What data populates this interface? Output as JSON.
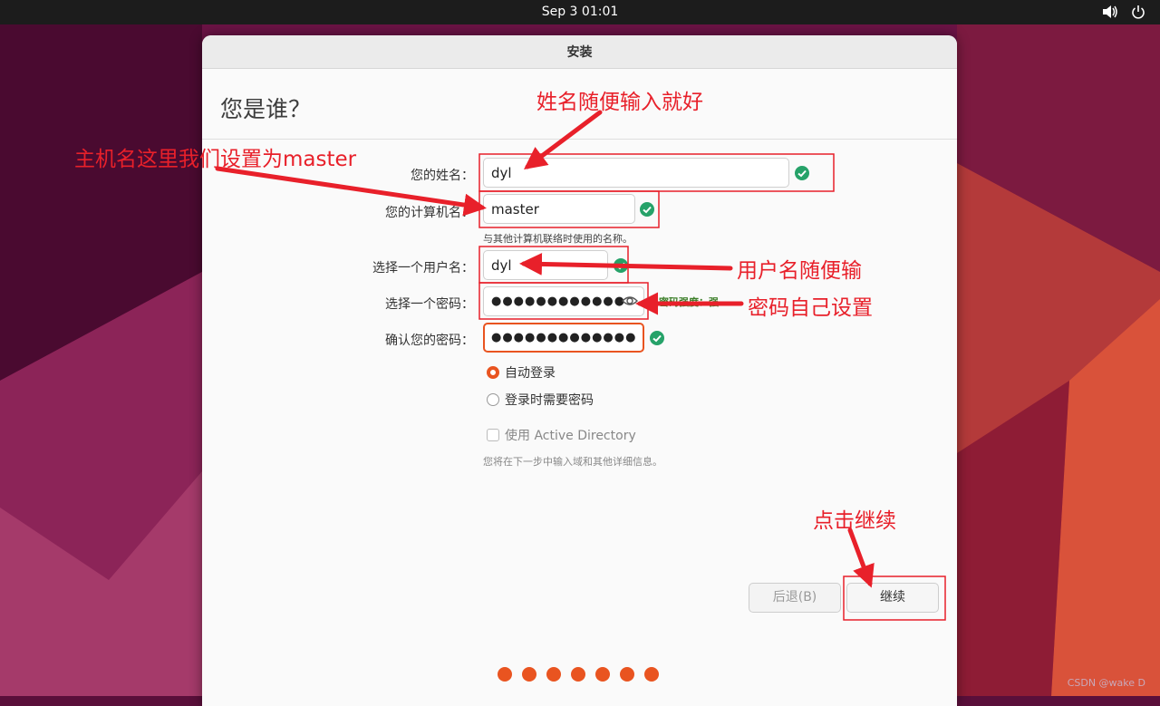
{
  "topbar": {
    "clock": "Sep 3  01:01",
    "icons": [
      "volume-icon",
      "power-icon"
    ]
  },
  "window": {
    "title": "安装",
    "heading": "您是谁？"
  },
  "form": {
    "name_label": "您的姓名：",
    "name_value": "dyl",
    "computer_label": "您的计算机名：",
    "computer_value": "master",
    "computer_hint": "与其他计算机联络时使用的名称。",
    "username_label": "选择一个用户名：",
    "username_value": "dyl",
    "password_label": "选择一个密码：",
    "password_value": "●●●●●●●●●●●●",
    "password_strength": "密码强度：强",
    "confirm_label": "确认您的密码：",
    "confirm_value": "●●●●●●●●●●●●●",
    "auto_login": "自动登录",
    "require_password": "登录时需要密码",
    "active_directory": "使用 Active Directory",
    "ad_info": "您将在下一步中输入域和其他详细信息。"
  },
  "buttons": {
    "back": "后退(B)",
    "continue": "继续"
  },
  "pager": {
    "count": 7,
    "color": "#e95420"
  },
  "annotations": {
    "name": "姓名随便输入就好",
    "hostname": "主机名这里我们设置为master",
    "username": "用户名随便输",
    "password": "密码自己设置",
    "click_continue": "点击继续"
  },
  "watermark": "CSDN @wake D",
  "colors": {
    "accent": "#e95420",
    "annotation": "#e8202a",
    "check": "#26a269"
  }
}
